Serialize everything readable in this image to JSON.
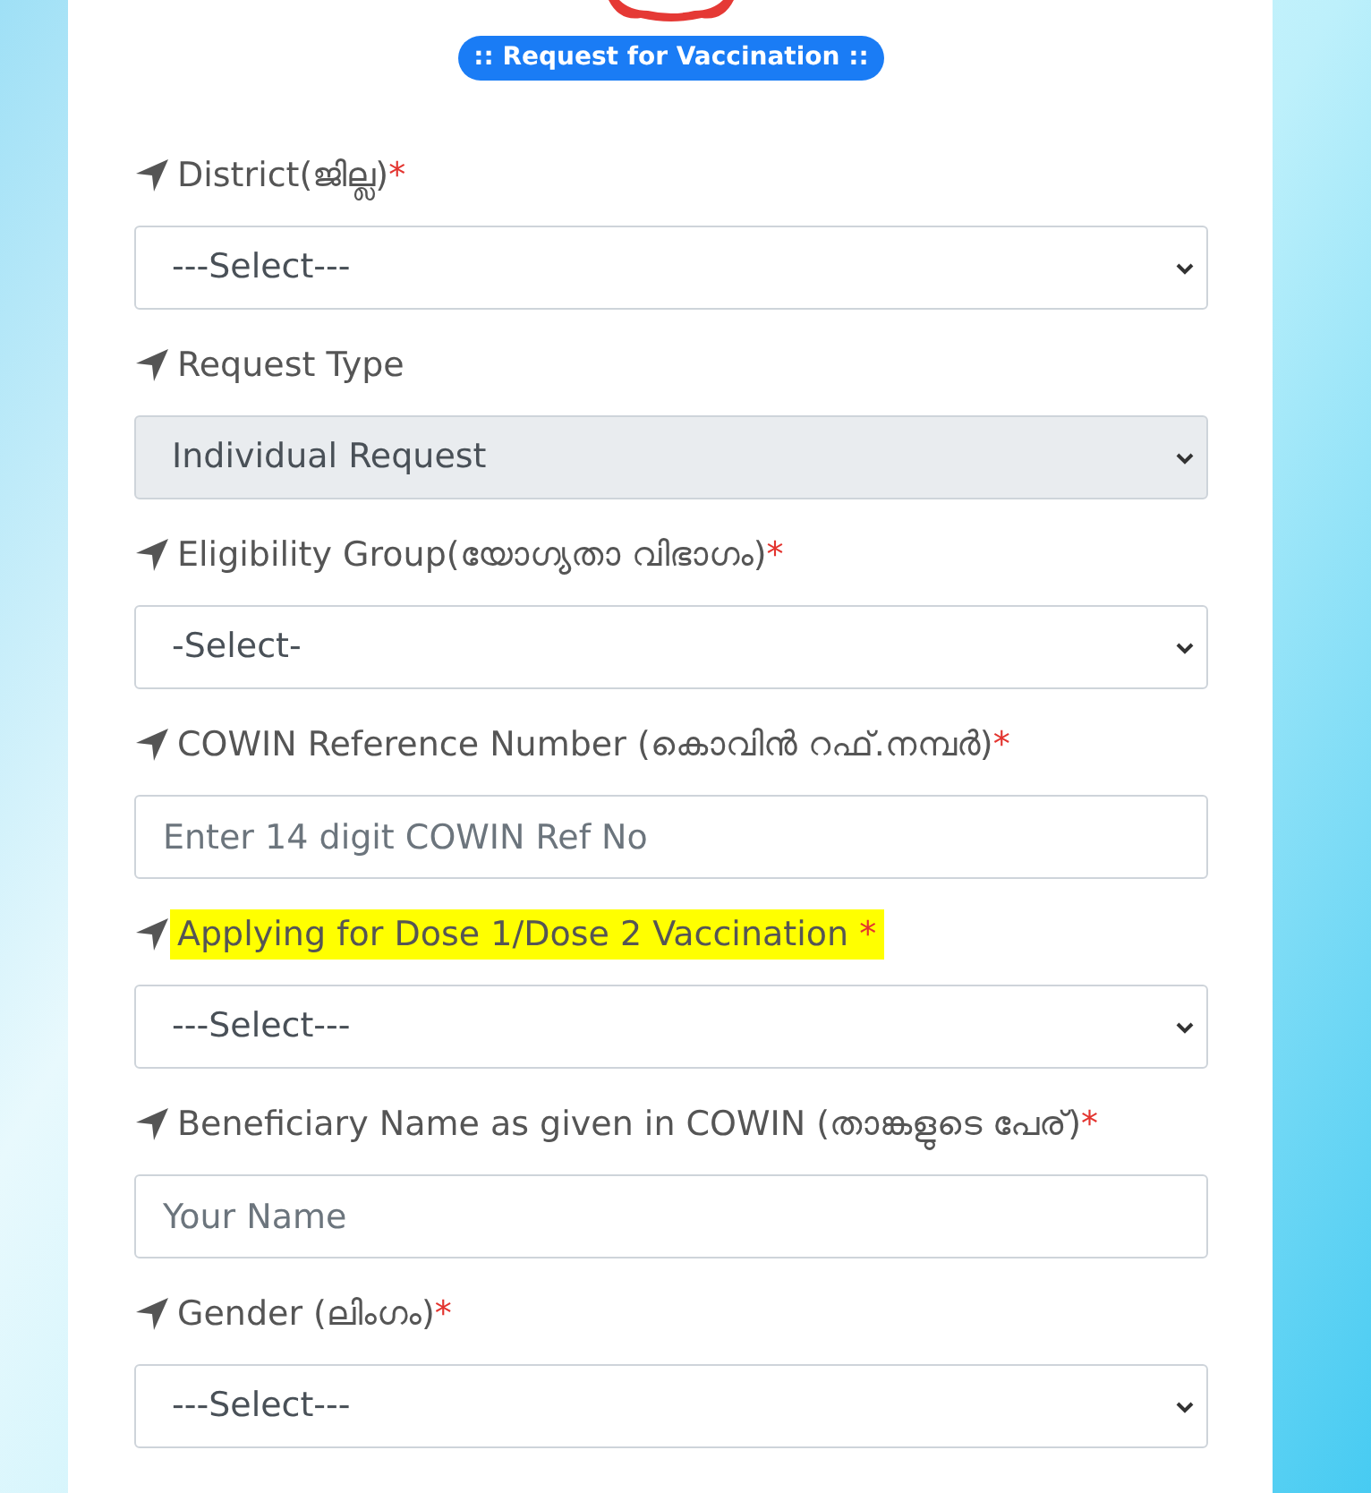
{
  "header": {
    "badge": ":: Request for Vaccination ::"
  },
  "fields": [
    {
      "kind": "select",
      "label": "District(ജില്ല)",
      "required_mark": "*",
      "highlighted": false,
      "value": "---Select---"
    },
    {
      "kind": "select",
      "label": "Request Type",
      "highlighted": false,
      "disabled": true,
      "value": "Individual Request"
    },
    {
      "kind": "select",
      "label": "Eligibility Group(യോഗ്യതാ വിഭാഗം)",
      "required_mark": "*",
      "highlighted": false,
      "value": "-Select-"
    },
    {
      "kind": "input",
      "label": "COWIN Reference Number (കൊവിൻ റഫ്.നമ്പർ)",
      "required_mark": "*",
      "highlighted": false,
      "placeholder": "Enter 14 digit COWIN Ref No"
    },
    {
      "kind": "select",
      "label": "Applying for Dose 1/Dose 2 Vaccination ",
      "required_mark": "*",
      "highlighted": true,
      "value": "---Select---"
    },
    {
      "kind": "input",
      "label": "Beneficiary Name as given in COWIN (താങ്കളുടെ പേര്)",
      "required_mark": "*",
      "highlighted": false,
      "placeholder": "Your Name"
    },
    {
      "kind": "select",
      "label": "Gender (ലിംഗം)",
      "required_mark": "*",
      "highlighted": false,
      "value": "---Select---"
    }
  ]
}
